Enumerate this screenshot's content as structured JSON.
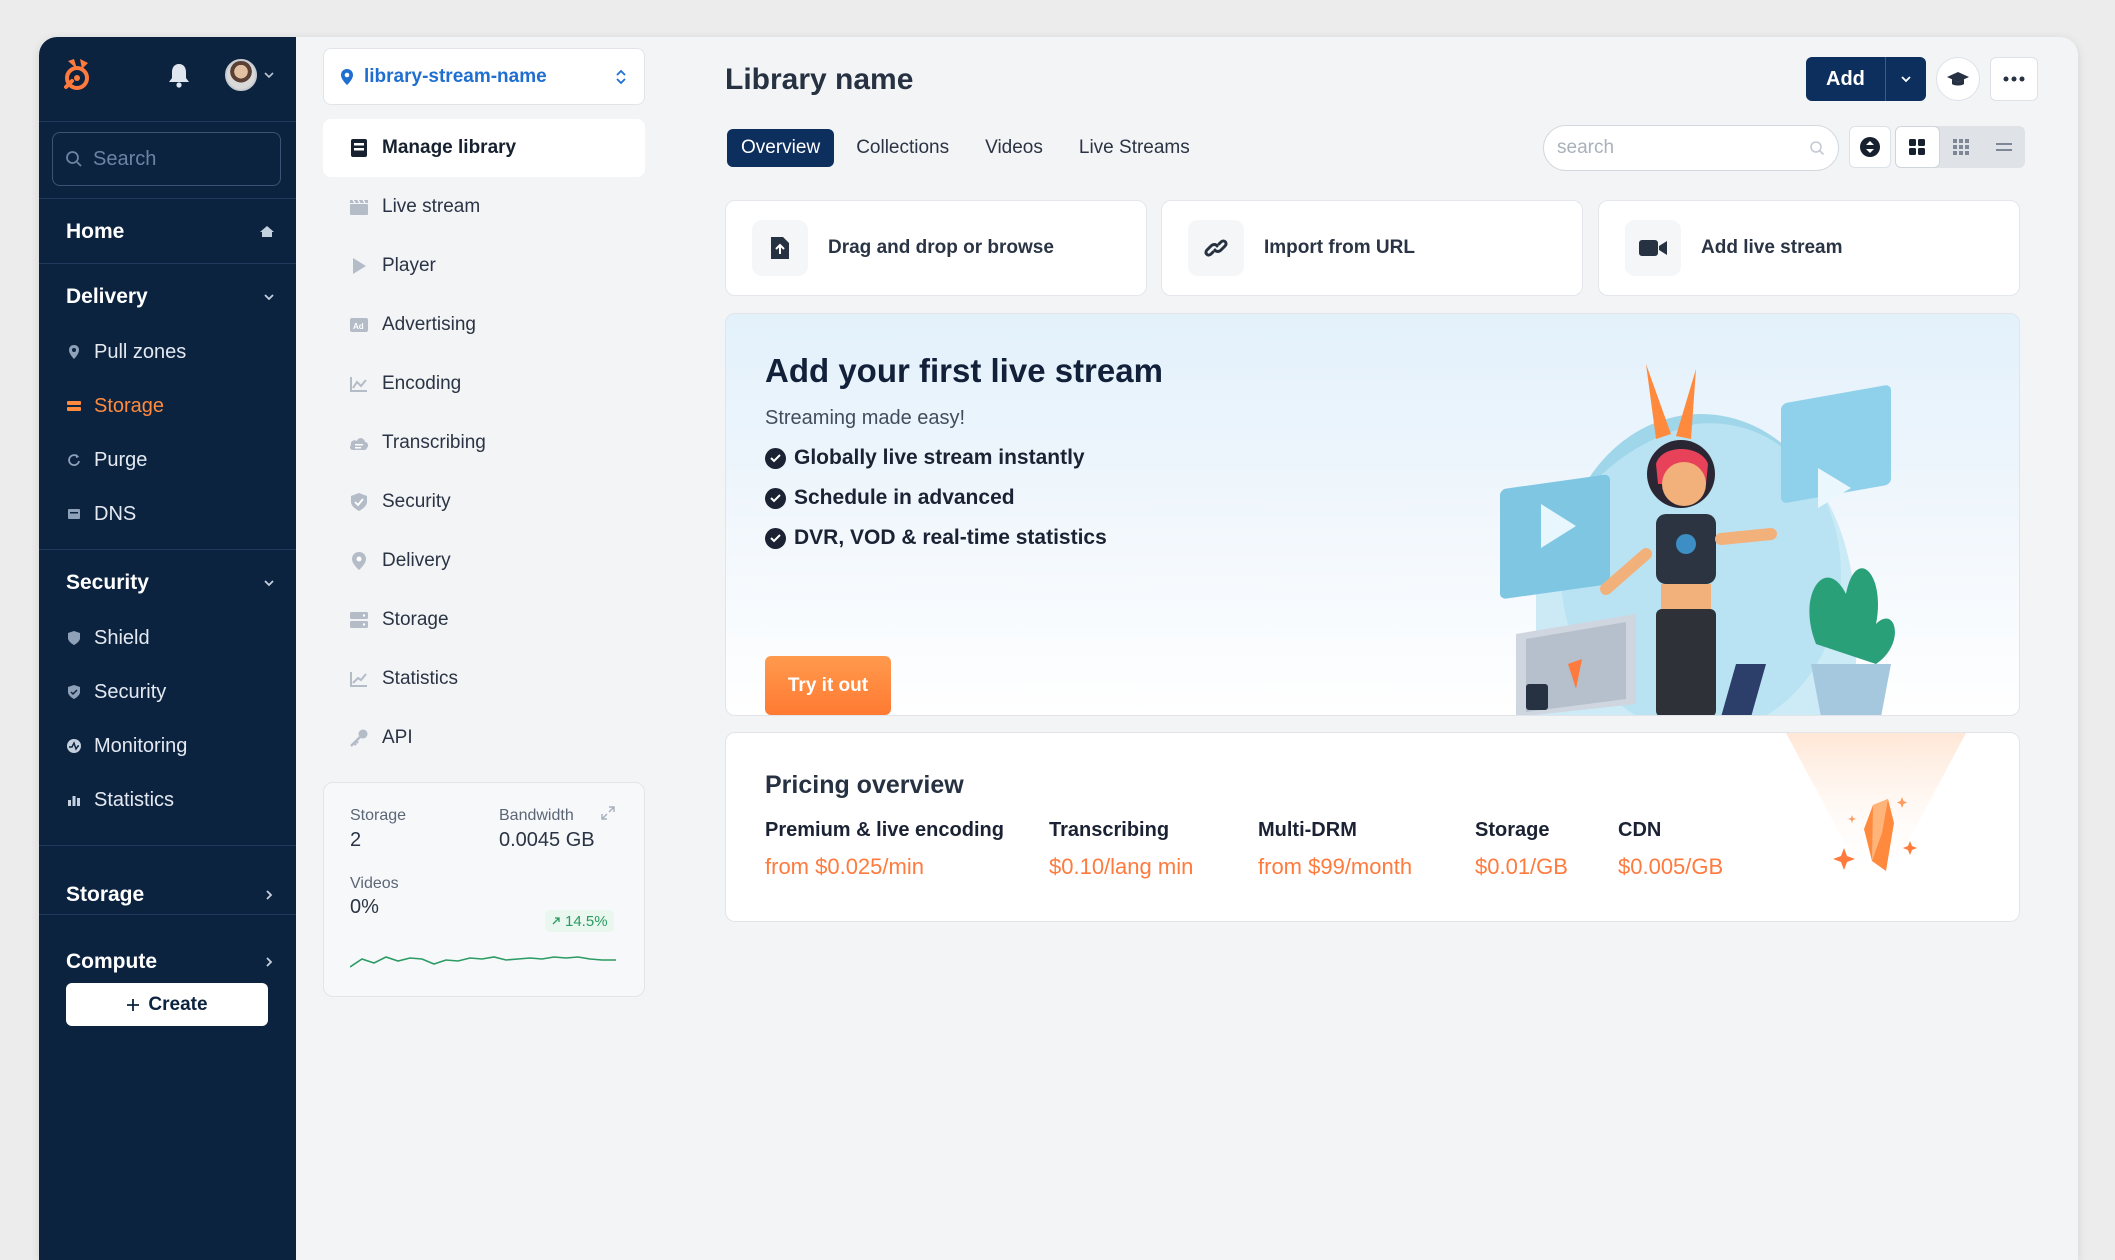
{
  "nav": {
    "search_placeholder": "Search",
    "home": "Home",
    "delivery": {
      "label": "Delivery",
      "items": [
        "Pull zones",
        "Storage",
        "Purge",
        "DNS"
      ]
    },
    "security": {
      "label": "Security",
      "items": [
        "Shield",
        "Security",
        "Monitoring",
        "Statistics"
      ]
    },
    "storage": "Storage",
    "compute": "Compute",
    "create": "Create",
    "active_item": "Storage",
    "accent": "#ff8a3d"
  },
  "library": {
    "selector": "library-stream-name",
    "menu": [
      "Manage library",
      "Live stream",
      "Player",
      "Advertising",
      "Encoding",
      "Transcribing",
      "Security",
      "Delivery",
      "Storage",
      "Statistics",
      "API"
    ],
    "stats": {
      "storage_label": "Storage",
      "storage_value": "2",
      "bandwidth_label": "Bandwidth",
      "bandwidth_value": "0.0045 GB",
      "videos_label": "Videos",
      "videos_value": "0%",
      "trend": "14.5%"
    }
  },
  "main": {
    "title": "Library name",
    "add_label": "Add",
    "tabs": [
      "Overview",
      "Collections",
      "Videos",
      "Live Streams"
    ],
    "search_placeholder": "search",
    "actions": [
      "Drag and drop or browse",
      "Import from URL",
      "Add live stream"
    ],
    "hero": {
      "title": "Add your first live stream",
      "subtitle": "Streaming made easy!",
      "bullets": [
        "Globally live stream instantly",
        "Schedule in advanced",
        "DVR, VOD & real-time statistics"
      ],
      "cta": "Try it out"
    },
    "pricing": {
      "title": "Pricing overview",
      "items": [
        {
          "name": "Premium & live encoding",
          "value": "from $0.025/min"
        },
        {
          "name": "Transcribing",
          "value": "$0.10/lang min"
        },
        {
          "name": "Multi-DRM",
          "value": "from $99/month"
        },
        {
          "name": "Storage",
          "value": "$0.01/GB"
        },
        {
          "name": "CDN",
          "value": "$0.005/GB"
        }
      ]
    }
  }
}
